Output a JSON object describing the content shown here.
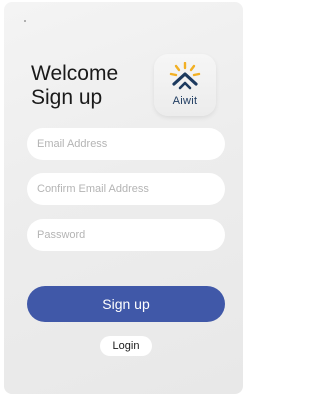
{
  "header": {
    "title_line1": "Welcome",
    "title_line2": "Sign up"
  },
  "logo": {
    "text": "Aiwit",
    "icon": "aiwit-logo-icon",
    "colors": {
      "rays": "#f2b024",
      "mark": "#1d3a5f",
      "tile": "#efefef"
    }
  },
  "form": {
    "email_placeholder": "Email Address",
    "confirm_email_placeholder": "Confirm Email Address",
    "password_placeholder": "Password",
    "email_value": "",
    "confirm_email_value": "",
    "password_value": ""
  },
  "actions": {
    "signup_label": "Sign up",
    "login_label": "Login"
  },
  "colors": {
    "primary": "#4058a8",
    "background": "#ededed",
    "field": "#ffffff"
  }
}
